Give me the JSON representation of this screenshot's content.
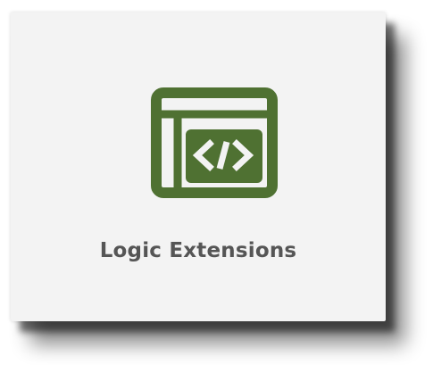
{
  "tile": {
    "label": "Logic Extensions",
    "icon": "code-window-icon"
  },
  "colors": {
    "icon": "#4f7132",
    "label": "#555555",
    "tile_background": "#f3f3f3"
  }
}
